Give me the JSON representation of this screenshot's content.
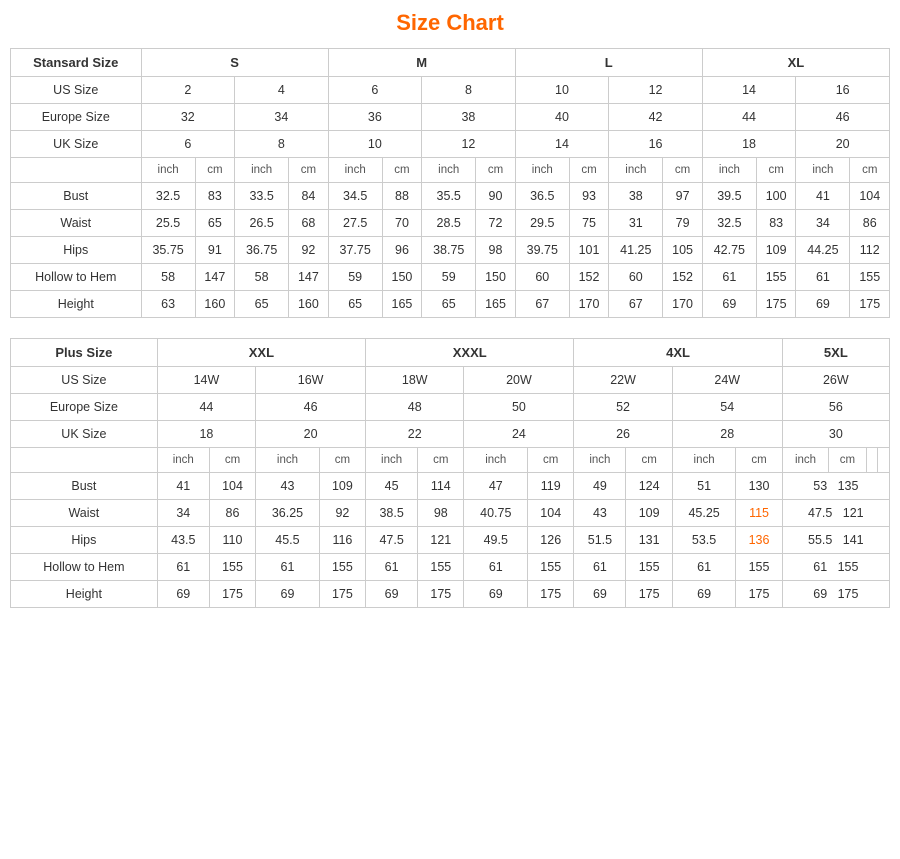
{
  "title": "Size Chart",
  "standard": {
    "label": "Stansard Size",
    "sizes": {
      "S": {
        "label": "S",
        "us": [
          "2",
          "4"
        ],
        "eu": [
          "32",
          "34"
        ],
        "uk": [
          "6",
          "8"
        ],
        "bust_in": [
          "32.5",
          "33.5"
        ],
        "bust_cm": [
          "83",
          "84"
        ],
        "waist_in": [
          "25.5",
          "26.5"
        ],
        "waist_cm": [
          "65",
          "68"
        ],
        "hips_in": [
          "35.75",
          "36.75"
        ],
        "hips_cm": [
          "91",
          "92"
        ],
        "hollow_in": [
          "58",
          "58"
        ],
        "hollow_cm": [
          "147",
          "147"
        ],
        "height_in": [
          "63",
          "65"
        ],
        "height_cm": [
          "160",
          "160"
        ]
      },
      "M": {
        "label": "M",
        "us": [
          "6",
          "8"
        ],
        "eu": [
          "36",
          "38"
        ],
        "uk": [
          "10",
          "12"
        ],
        "bust_in": [
          "34.5",
          "35.5"
        ],
        "bust_cm": [
          "88",
          "90"
        ],
        "waist_in": [
          "27.5",
          "28.5"
        ],
        "waist_cm": [
          "70",
          "72"
        ],
        "hips_in": [
          "37.75",
          "38.75"
        ],
        "hips_cm": [
          "96",
          "98"
        ],
        "hollow_in": [
          "59",
          "59"
        ],
        "hollow_cm": [
          "150",
          "150"
        ],
        "height_in": [
          "65",
          "65"
        ],
        "height_cm": [
          "165",
          "165"
        ]
      },
      "L": {
        "label": "L",
        "us": [
          "10",
          "12"
        ],
        "eu": [
          "40",
          "42"
        ],
        "uk": [
          "14",
          "16"
        ],
        "bust_in": [
          "36.5",
          "38"
        ],
        "bust_cm": [
          "93",
          "97"
        ],
        "waist_in": [
          "29.5",
          "31"
        ],
        "waist_cm": [
          "75",
          "79"
        ],
        "hips_in": [
          "39.75",
          "41.25"
        ],
        "hips_cm": [
          "101",
          "105"
        ],
        "hollow_in": [
          "60",
          "60"
        ],
        "hollow_cm": [
          "152",
          "152"
        ],
        "height_in": [
          "67",
          "67"
        ],
        "height_cm": [
          "170",
          "170"
        ]
      },
      "XL": {
        "label": "XL",
        "us": [
          "14",
          "16"
        ],
        "eu": [
          "44",
          "46"
        ],
        "uk": [
          "18",
          "20"
        ],
        "bust_in": [
          "39.5",
          "41"
        ],
        "bust_cm": [
          "100",
          "104"
        ],
        "waist_in": [
          "32.5",
          "34"
        ],
        "waist_cm": [
          "83",
          "86"
        ],
        "hips_in": [
          "42.75",
          "44.25"
        ],
        "hips_cm": [
          "109",
          "112"
        ],
        "hollow_in": [
          "61",
          "61"
        ],
        "hollow_cm": [
          "155",
          "155"
        ],
        "height_in": [
          "69",
          "69"
        ],
        "height_cm": [
          "175",
          "175"
        ]
      }
    },
    "rows": [
      "Bust",
      "Waist",
      "Hips",
      "Hollow to Hem",
      "Height"
    ]
  },
  "plus": {
    "label": "Plus Size",
    "sizes": {
      "XXL": {
        "label": "XXL",
        "us": [
          "14W",
          "16W"
        ],
        "eu": [
          "44",
          "46"
        ],
        "uk": [
          "18",
          "20"
        ],
        "bust_in": [
          "41",
          "43"
        ],
        "bust_cm": [
          "104",
          "109"
        ],
        "waist_in": [
          "34",
          "36.25"
        ],
        "waist_cm": [
          "86",
          "92"
        ],
        "hips_in": [
          "43.5",
          "45.5"
        ],
        "hips_cm": [
          "110",
          "116"
        ],
        "hollow_in": [
          "61",
          "61"
        ],
        "hollow_cm": [
          "155",
          "155"
        ],
        "height_in": [
          "69",
          "69"
        ],
        "height_cm": [
          "175",
          "175"
        ]
      },
      "XXXL": {
        "label": "XXXL",
        "us": [
          "18W",
          "20W"
        ],
        "eu": [
          "48",
          "50"
        ],
        "uk": [
          "22",
          "24"
        ],
        "bust_in": [
          "45",
          "47"
        ],
        "bust_cm": [
          "114",
          "119"
        ],
        "waist_in": [
          "38.5",
          "40.75"
        ],
        "waist_cm": [
          "98",
          "104"
        ],
        "hips_in": [
          "47.5",
          "49.5"
        ],
        "hips_cm": [
          "121",
          "126"
        ],
        "hollow_in": [
          "61",
          "61"
        ],
        "hollow_cm": [
          "155",
          "155"
        ],
        "height_in": [
          "69",
          "69"
        ],
        "height_cm": [
          "175",
          "175"
        ]
      },
      "4XL": {
        "label": "4XL",
        "us": [
          "22W",
          "24W"
        ],
        "eu": [
          "52",
          "54"
        ],
        "uk": [
          "26",
          "28"
        ],
        "bust_in": [
          "49",
          "51"
        ],
        "bust_cm": [
          "124",
          "130"
        ],
        "waist_in": [
          "43",
          "45.25"
        ],
        "waist_cm": [
          "109",
          "115"
        ],
        "hips_in": [
          "51.5",
          "53.5"
        ],
        "hips_cm": [
          "131",
          "136"
        ],
        "hollow_in": [
          "61",
          "61"
        ],
        "hollow_cm": [
          "155",
          "155"
        ],
        "height_in": [
          "69",
          "69"
        ],
        "height_cm": [
          "175",
          "175"
        ]
      },
      "5XL": {
        "label": "5XL",
        "us": [
          "26W"
        ],
        "eu": [
          "56"
        ],
        "uk": [
          "30"
        ],
        "bust_in": [
          "53"
        ],
        "bust_cm": [
          "135"
        ],
        "waist_in": [
          "47.5"
        ],
        "waist_cm": [
          "121"
        ],
        "hips_in": [
          "55.5"
        ],
        "hips_cm": [
          "141"
        ],
        "hollow_in": [
          "61"
        ],
        "hollow_cm": [
          "155"
        ],
        "height_in": [
          "69"
        ],
        "height_cm": [
          "175"
        ]
      }
    }
  },
  "units": {
    "inch": "inch",
    "cm": "cm"
  },
  "row_labels": {
    "bust": "Bust",
    "waist": "Waist",
    "hips": "Hips",
    "hollow": "Hollow to Hem",
    "height": "Height"
  }
}
